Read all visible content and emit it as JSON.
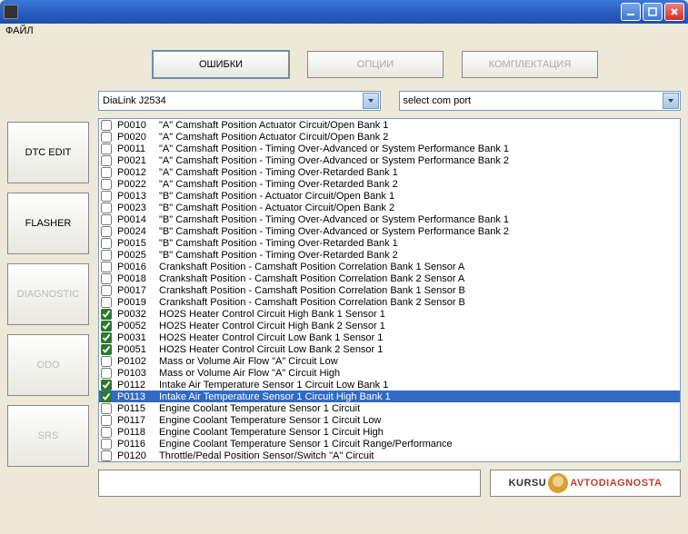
{
  "menubar": {
    "file": "ФАЙЛ"
  },
  "tabs": {
    "errors": "ОШИБКИ",
    "options": "ОПЦИИ",
    "config": "КОМПЛЕКТАЦИЯ"
  },
  "combos": {
    "device": "DiaLink J2534",
    "port": "select com port"
  },
  "sidebar": {
    "dtc_edit": "DTC EDIT",
    "flasher": "FLASHER",
    "diagnostic": "DIAGNOSTIC",
    "odo": "ODO",
    "srs": "SRS"
  },
  "logo": {
    "left": "KURSU",
    "right": "AVTODIAGNOSTA"
  },
  "dtc_list": [
    {
      "code": "P0010",
      "desc": "\"A\" Camshaft Position Actuator Circuit/Open Bank 1",
      "checked": false
    },
    {
      "code": "P0020",
      "desc": "\"A\" Camshaft Position Actuator Circuit/Open Bank 2",
      "checked": false
    },
    {
      "code": "P0011",
      "desc": "\"A\" Camshaft Position - Timing Over-Advanced or System Performance Bank 1",
      "checked": false
    },
    {
      "code": "P0021",
      "desc": "\"A\" Camshaft Position - Timing Over-Advanced or System Performance Bank 2",
      "checked": false
    },
    {
      "code": "P0012",
      "desc": "\"A\" Camshaft Position - Timing Over-Retarded Bank 1",
      "checked": false
    },
    {
      "code": "P0022",
      "desc": "\"A\" Camshaft Position - Timing Over-Retarded Bank 2",
      "checked": false
    },
    {
      "code": "P0013",
      "desc": "\"B\" Camshaft Position - Actuator Circuit/Open Bank 1",
      "checked": false
    },
    {
      "code": "P0023",
      "desc": "\"B\" Camshaft Position - Actuator Circuit/Open Bank 2",
      "checked": false
    },
    {
      "code": "P0014",
      "desc": "\"B\" Camshaft Position - Timing Over-Advanced or System Performance Bank 1",
      "checked": false
    },
    {
      "code": "P0024",
      "desc": "\"B\" Camshaft Position - Timing Over-Advanced or System Performance Bank 2",
      "checked": false
    },
    {
      "code": "P0015",
      "desc": "\"B\" Camshaft Position - Timing Over-Retarded Bank 1",
      "checked": false
    },
    {
      "code": "P0025",
      "desc": "\"B\" Camshaft Position - Timing Over-Retarded Bank 2",
      "checked": false
    },
    {
      "code": "P0016",
      "desc": "Crankshaft Position - Camshaft Position Correlation Bank 1 Sensor A",
      "checked": false
    },
    {
      "code": "P0018",
      "desc": "Crankshaft Position - Camshaft Position Correlation Bank 2 Sensor A",
      "checked": false
    },
    {
      "code": "P0017",
      "desc": "Crankshaft Position - Camshaft Position Correlation Bank 1 Sensor B",
      "checked": false
    },
    {
      "code": "P0019",
      "desc": "Crankshaft Position - Camshaft Position Correlation Bank 2 Sensor B",
      "checked": false
    },
    {
      "code": "P0032",
      "desc": "HO2S Heater Control Circuit High Bank 1 Sensor 1",
      "checked": true
    },
    {
      "code": "P0052",
      "desc": "HO2S Heater Control Circuit High Bank 2 Sensor 1",
      "checked": true
    },
    {
      "code": "P0031",
      "desc": "HO2S Heater Control Circuit Low Bank 1 Sensor 1",
      "checked": true
    },
    {
      "code": "P0051",
      "desc": "HO2S Heater Control Circuit Low Bank 2 Sensor 1",
      "checked": true
    },
    {
      "code": "P0102",
      "desc": "Mass or Volume Air Flow \"A\" Circuit Low",
      "checked": false
    },
    {
      "code": "P0103",
      "desc": "Mass or Volume Air Flow \"A\" Circuit High",
      "checked": false
    },
    {
      "code": "P0112",
      "desc": "Intake Air Temperature Sensor 1 Circuit Low Bank 1",
      "checked": true
    },
    {
      "code": "P0113",
      "desc": "Intake Air Temperature Sensor 1 Circuit High Bank 1",
      "checked": true,
      "selected": true
    },
    {
      "code": "P0115",
      "desc": "Engine Coolant Temperature Sensor 1 Circuit",
      "checked": false
    },
    {
      "code": "P0117",
      "desc": "Engine Coolant Temperature Sensor 1 Circuit Low",
      "checked": false
    },
    {
      "code": "P0118",
      "desc": "Engine Coolant Temperature Sensor 1 Circuit High",
      "checked": false
    },
    {
      "code": "P0116",
      "desc": "Engine Coolant Temperature Sensor 1 Circuit Range/Performance",
      "checked": false
    },
    {
      "code": "P0120",
      "desc": "Throttle/Pedal Position Sensor/Switch \"A\" Circuit",
      "checked": false
    }
  ]
}
